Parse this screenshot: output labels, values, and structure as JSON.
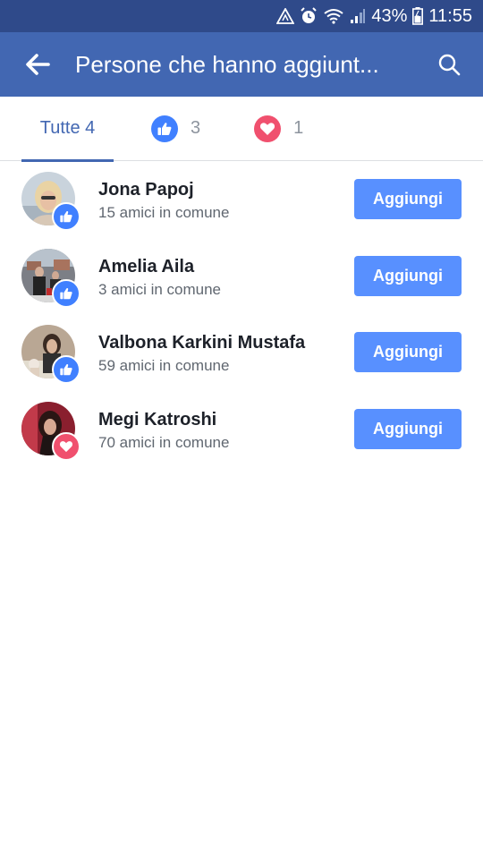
{
  "status_bar": {
    "battery": "43%",
    "time": "11:55",
    "icons": [
      "warning-triangle-icon",
      "alarm-icon",
      "wifi-icon",
      "signal-icon",
      "battery-icon"
    ]
  },
  "header": {
    "title": "Persone che hanno aggiunt...",
    "back_icon": "arrow-left-icon",
    "search_icon": "search-icon"
  },
  "tabs": {
    "all_label": "Tutte 4",
    "like_count": "3",
    "love_count": "1"
  },
  "people": [
    {
      "name": "Jona Papoj",
      "mutual": "15 amici in comune",
      "reaction": "like",
      "button": "Aggiungi"
    },
    {
      "name": "Amelia Aila",
      "mutual": "3 amici in comune",
      "reaction": "like",
      "button": "Aggiungi"
    },
    {
      "name": "Valbona Karkini Mustafa",
      "mutual": "59 amici in comune",
      "reaction": "like",
      "button": "Aggiungi"
    },
    {
      "name": "Megi Katroshi",
      "mutual": "70 amici in comune",
      "reaction": "love",
      "button": "Aggiungi"
    }
  ],
  "colors": {
    "status_bar": "#2f4a8a",
    "app_bar": "#4267b2",
    "accent": "#4267b2",
    "button": "#5890ff",
    "like": "#4080ff",
    "love": "#f0506e"
  }
}
